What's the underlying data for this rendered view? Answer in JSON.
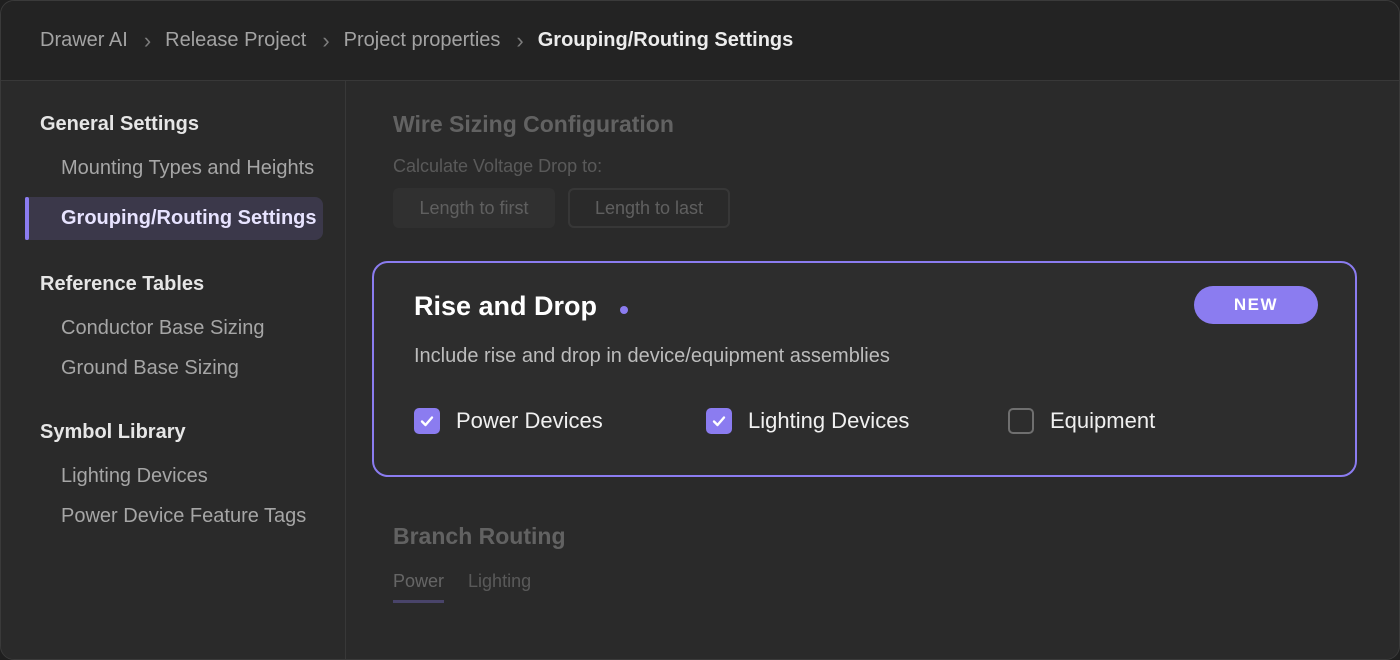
{
  "breadcrumb": {
    "items": [
      "Drawer AI",
      "Release Project",
      "Project properties",
      "Grouping/Routing Settings"
    ],
    "separator": "›"
  },
  "sidebar": {
    "sections": [
      {
        "heading": "General Settings",
        "items": [
          "Mounting Types and Heights",
          "Grouping/Routing Settings"
        ]
      },
      {
        "heading": "Reference Tables",
        "items": [
          "Conductor Base Sizing",
          "Ground Base Sizing"
        ]
      },
      {
        "heading": "Symbol Library",
        "items": [
          "Lighting Devices",
          "Power Device Feature Tags"
        ]
      }
    ],
    "active_item": "Grouping/Routing Settings"
  },
  "wire_sizing": {
    "title": "Wire Sizing Configuration",
    "label": "Calculate Voltage Drop to:",
    "options": [
      "Length to first",
      "Length to last"
    ]
  },
  "rise_drop": {
    "title": "Rise and Drop",
    "badge": "NEW",
    "description": "Include rise and drop in device/equipment assemblies",
    "options": [
      {
        "label": "Power Devices",
        "checked": true
      },
      {
        "label": "Lighting Devices",
        "checked": true
      },
      {
        "label": "Equipment",
        "checked": false
      }
    ]
  },
  "branch_routing": {
    "title": "Branch Routing",
    "tabs": [
      "Power",
      "Lighting"
    ],
    "active_tab": "Power"
  },
  "colors": {
    "accent": "#8b7cf0",
    "background": "#2a2a2a",
    "topbar": "#232323"
  },
  "icons": {
    "separator": "chevron-right-icon",
    "check": "check-icon"
  }
}
